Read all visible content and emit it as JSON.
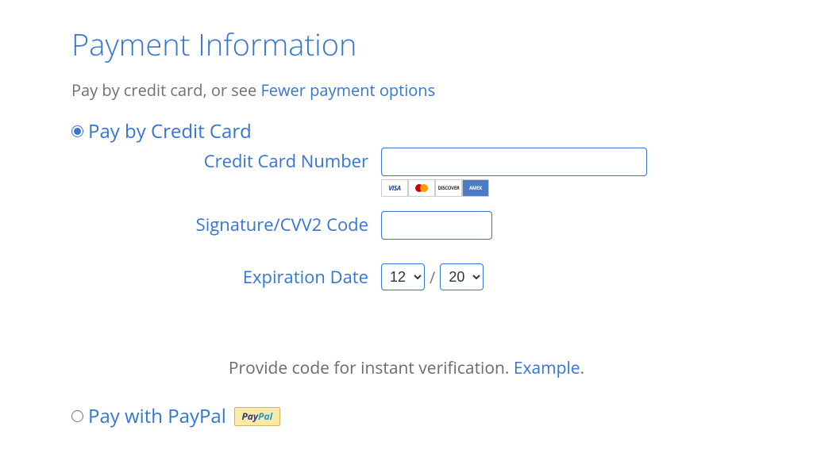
{
  "heading": "Payment Information",
  "subtitle_prefix": "Pay by credit card, or see ",
  "subtitle_link": "Fewer payment options",
  "credit_card": {
    "option_label": "Pay by Credit Card",
    "fields": {
      "number_label": "Credit Card Number",
      "number_value": "",
      "cvv_label": "Signature/CVV2 Code",
      "cvv_value": "",
      "exp_label": "Expiration Date",
      "exp_month": "12",
      "exp_year": "20",
      "separator": "/"
    },
    "card_brands": {
      "visa": "VISA",
      "discover": "DISCOVER",
      "amex": "AMEX"
    }
  },
  "verification": {
    "text": "Provide code for instant verification. ",
    "link": "Example",
    "period": "."
  },
  "paypal": {
    "option_label": "Pay with PayPal",
    "badge_pay": "Pay",
    "badge_pal": "Pal"
  }
}
